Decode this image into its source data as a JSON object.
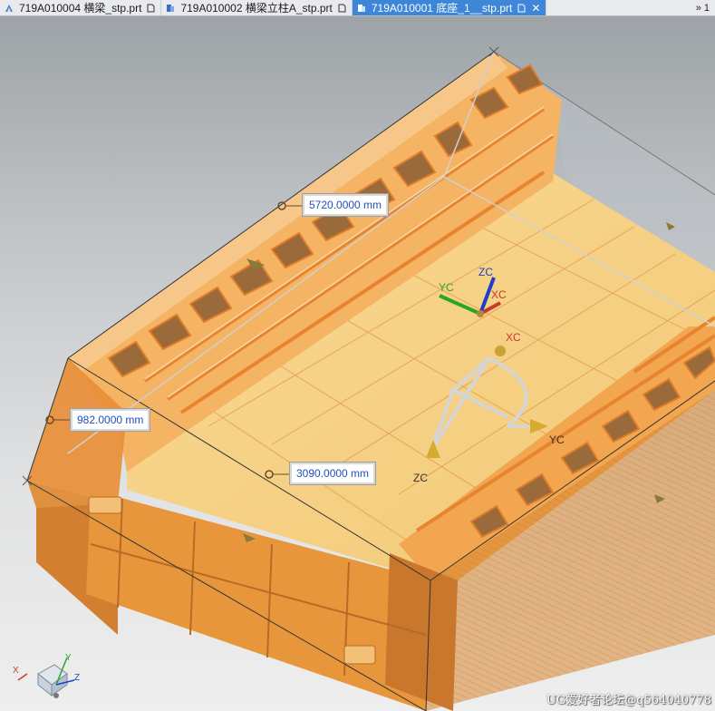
{
  "tabs": [
    {
      "label": "719A010004 横梁_stp.prt"
    },
    {
      "label": "719A010002 横梁立柱A_stp.prt"
    },
    {
      "label": "719A010001 底座_1__stp.prt",
      "active": true,
      "close": "✕"
    }
  ],
  "tab_overflow": {
    "arrow": "»",
    "count": "1"
  },
  "dimensions": {
    "length": "5720.0000 mm",
    "height": "982.0000 mm",
    "width": "3090.0000 mm"
  },
  "wcs": {
    "x": "XC",
    "y": "YC",
    "z": "ZC"
  },
  "dynamic_csys": {
    "x": "XC",
    "y": "YC",
    "z": "ZC"
  },
  "view_triad": {
    "x": "X",
    "y": "Y",
    "z": "Z"
  },
  "watermark": "UG爱好者论坛@q564040778",
  "colors": {
    "accent_tab": "#3d86d8",
    "part_orange": "#f0a04a",
    "part_floor": "#f7d48a",
    "dimension_text": "#1f4fbf"
  },
  "icons": [
    "part-file-icon",
    "assembly-icon",
    "document-icon",
    "close-icon"
  ]
}
